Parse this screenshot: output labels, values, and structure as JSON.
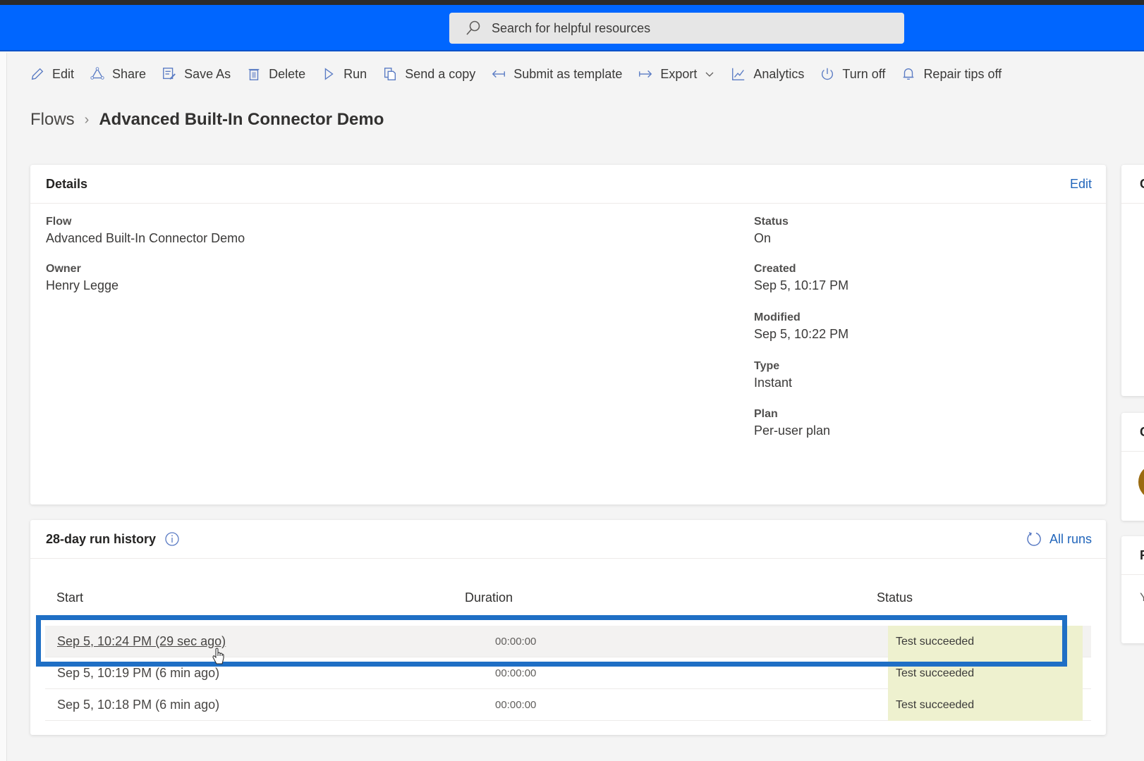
{
  "header": {
    "search_placeholder": "Search for helpful resources"
  },
  "toolbar": {
    "items": [
      {
        "label": "Edit",
        "icon": "pencil-icon"
      },
      {
        "label": "Share",
        "icon": "share-icon"
      },
      {
        "label": "Save As",
        "icon": "save-as-icon"
      },
      {
        "label": "Delete",
        "icon": "trash-icon"
      },
      {
        "label": "Run",
        "icon": "play-icon"
      },
      {
        "label": "Send a copy",
        "icon": "copy-icon"
      },
      {
        "label": "Submit as template",
        "icon": "arrow-left-icon"
      },
      {
        "label": "Export",
        "icon": "arrow-right-icon"
      },
      {
        "label": "Analytics",
        "icon": "chart-icon"
      },
      {
        "label": "Turn off",
        "icon": "power-icon"
      },
      {
        "label": "Repair tips off",
        "icon": "bell-icon"
      }
    ]
  },
  "breadcrumb": {
    "parent": "Flows",
    "current": "Advanced Built-In Connector Demo"
  },
  "details": {
    "title": "Details",
    "edit_label": "Edit",
    "left_fields": [
      {
        "label": "Flow",
        "value": "Advanced Built-In Connector Demo"
      },
      {
        "label": "Owner",
        "value": "Henry Legge"
      }
    ],
    "right_fields": [
      {
        "label": "Status",
        "value": "On"
      },
      {
        "label": "Created",
        "value": "Sep 5, 10:17 PM"
      },
      {
        "label": "Modified",
        "value": "Sep 5, 10:22 PM"
      },
      {
        "label": "Type",
        "value": "Instant"
      },
      {
        "label": "Plan",
        "value": "Per-user plan"
      }
    ]
  },
  "run_history": {
    "title": "28-day run history",
    "all_runs_label": "All runs",
    "columns": [
      "Start",
      "Duration",
      "Status"
    ],
    "rows": [
      {
        "start": "Sep 5, 10:24 PM (29 sec ago)",
        "duration": "00:00:00",
        "status": "Test succeeded"
      },
      {
        "start": "Sep 5, 10:19 PM (6 min ago)",
        "duration": "00:00:00",
        "status": "Test succeeded"
      },
      {
        "start": "Sep 5, 10:18 PM (6 min ago)",
        "duration": "00:00:00",
        "status": "Test succeeded"
      }
    ]
  },
  "side_panels": {
    "top_initial": "C",
    "middle_initial": "C",
    "bottom_initial": "R",
    "bottom_text": "Y"
  },
  "colors": {
    "header_blue": "#0066ff",
    "link_blue": "#2266bb",
    "status_success_bg": "#eef1cf",
    "highlight_border": "#1f6fc5"
  }
}
